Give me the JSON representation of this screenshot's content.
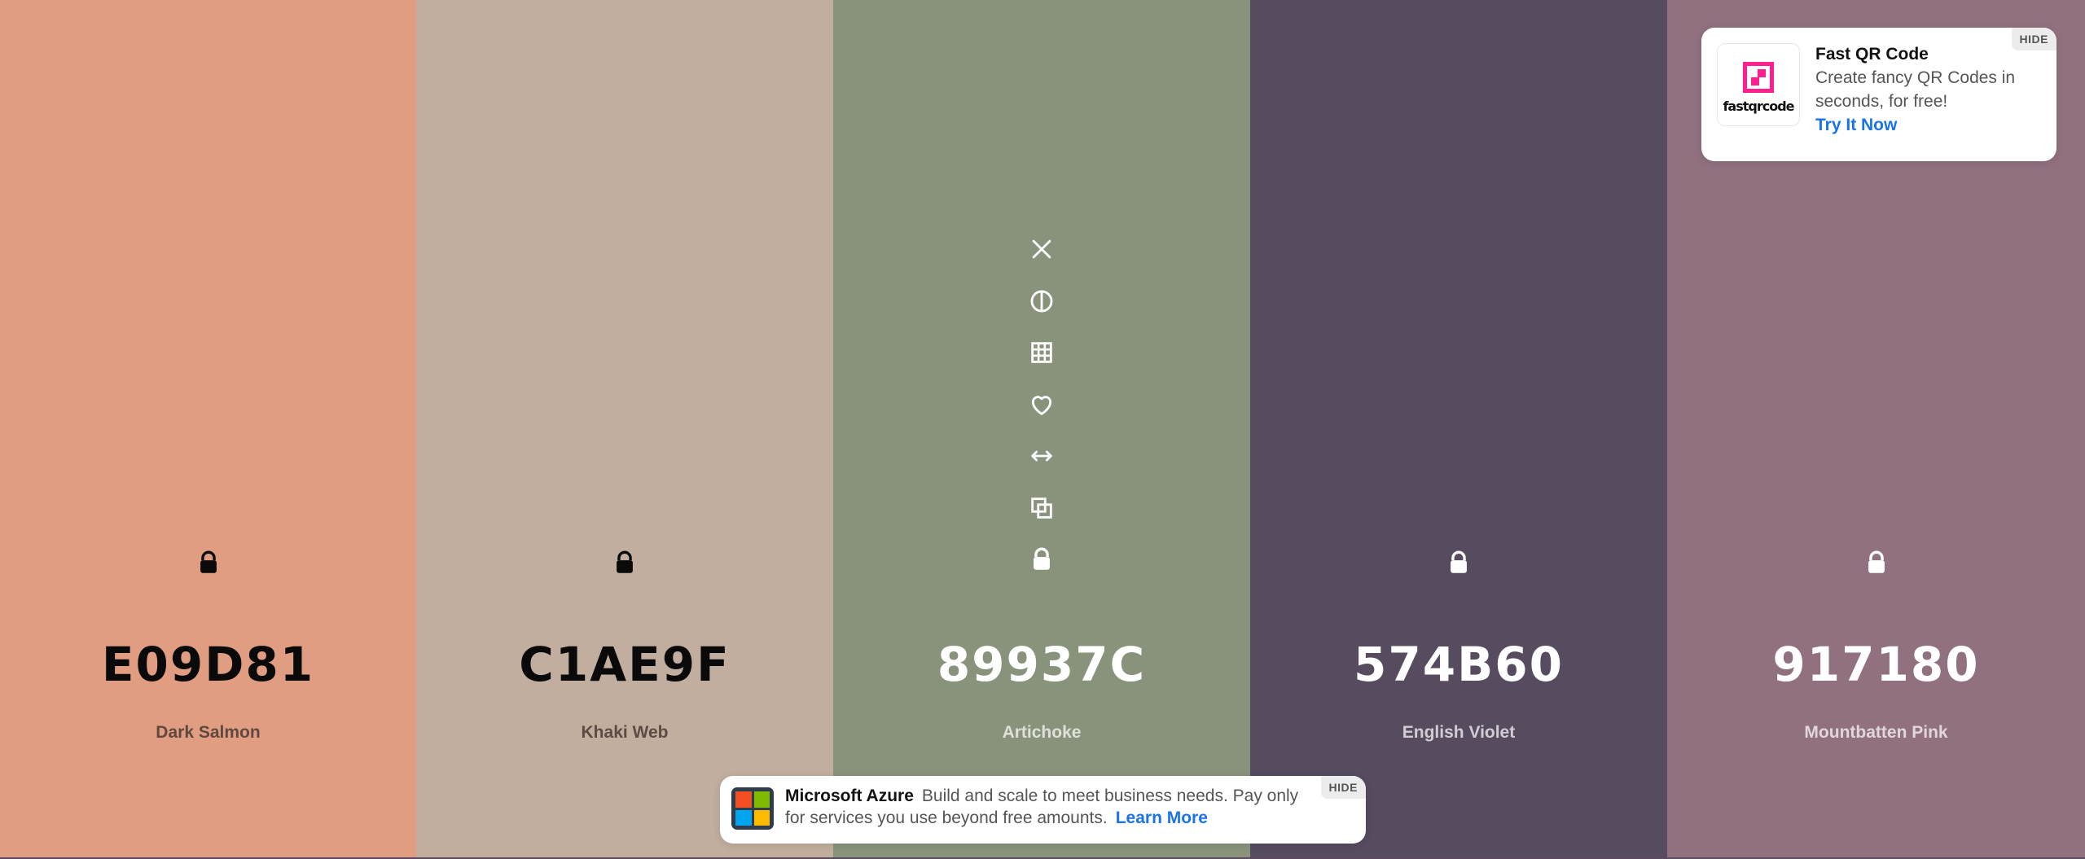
{
  "palette": {
    "colors": [
      {
        "hex": "E09D81",
        "name": "Dark Salmon",
        "bg": "#E09D81",
        "text_theme": "dark"
      },
      {
        "hex": "C1AE9F",
        "name": "Khaki Web",
        "bg": "#C1AE9F",
        "text_theme": "dark"
      },
      {
        "hex": "89937C",
        "name": "Artichoke",
        "bg": "#89937C",
        "text_theme": "light"
      },
      {
        "hex": "574B60",
        "name": "English Violet",
        "bg": "#574B60",
        "text_theme": "light"
      },
      {
        "hex": "917180",
        "name": "Mountbatten Pink",
        "bg": "#917180",
        "text_theme": "light"
      }
    ],
    "hovered_color_tools": [
      "close-icon",
      "contrast-icon",
      "grid-icon",
      "heart-icon",
      "swap-arrows-icon",
      "copy-icon",
      "lock-icon"
    ]
  },
  "ads": {
    "top": {
      "title": "Fast QR Code",
      "description": "Create fancy QR Codes in seconds, for free!",
      "cta": "Try It Now",
      "logo_text": "fastqrcode",
      "hide_label": "HIDE",
      "logo_color": "#ff1f8f"
    },
    "bottom": {
      "title": "Microsoft Azure",
      "description": "Build and scale to meet business needs. Pay only for services you use beyond free amounts.",
      "cta": "Learn More",
      "hide_label": "HIDE"
    }
  }
}
